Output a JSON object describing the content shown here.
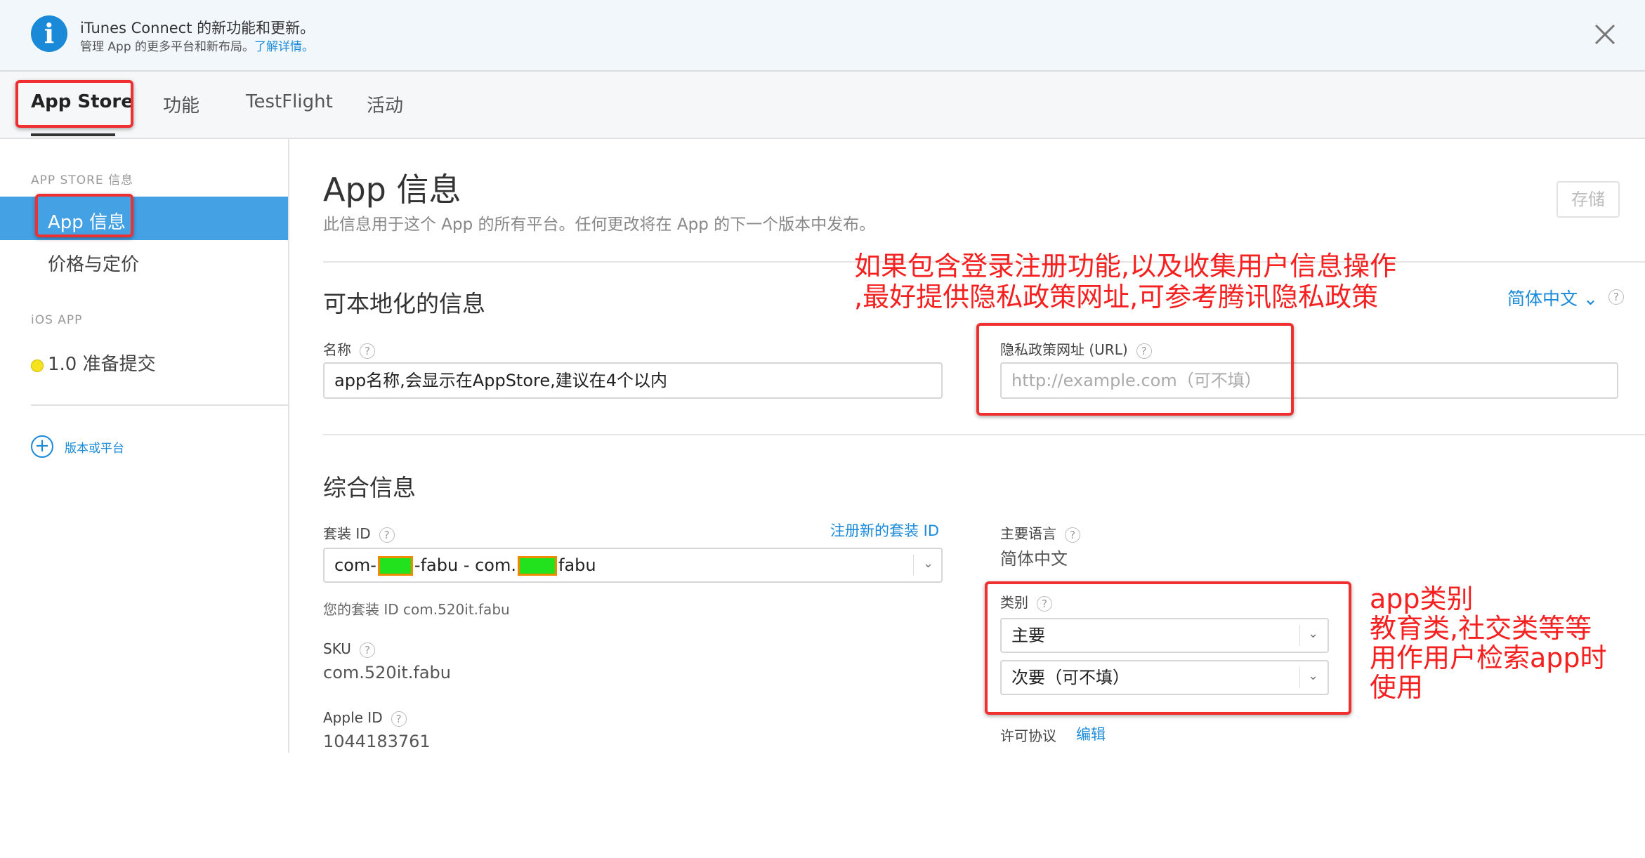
{
  "banner": {
    "title": "iTunes Connect 的新功能和更新。",
    "subtitle": "管理 App 的更多平台和新布局。",
    "link": "了解详情。"
  },
  "tabs": [
    "App Store",
    "功能",
    "TestFlight",
    "活动"
  ],
  "sidebar": {
    "section_info": "APP STORE 信息",
    "items": [
      "App 信息",
      "价格与定价"
    ],
    "section_ios": "iOS APP",
    "version": "1.0 准备提交",
    "add_link": "版本或平台"
  },
  "main": {
    "title": "App 信息",
    "description": "此信息用于这个 App 的所有平台。任何更改将在 App 的下一个版本中发布。",
    "save_label": "存储",
    "localizable": {
      "heading": "可本地化的信息",
      "language": "简体中文 ⌄",
      "name_label": "名称",
      "name_value": "app名称,会显示在AppStore,建议在4个以内",
      "privacy_label": "隐私政策网址 (URL)",
      "privacy_placeholder": "http://example.com（可不填）"
    },
    "general": {
      "heading": "综合信息",
      "bundle_label": "套装 ID",
      "register_bundle": "注册新的套装 ID",
      "bundle_value_a": "com-",
      "bundle_value_b": "-fabu - com.",
      "bundle_value_c": "fabu",
      "your_bundle_prefix": "您的套装 ID",
      "your_bundle_value": "com.520it.fabu",
      "sku_label": "SKU",
      "sku_value": "com.520it.fabu",
      "apple_id_label": "Apple ID",
      "apple_id_value": "1044183761",
      "primary_language_label": "主要语言",
      "primary_language_value": "简体中文",
      "category_label": "类别",
      "category_primary": "主要",
      "category_secondary": "次要（可不填）",
      "license_label": "许可协议",
      "license_edit": "编辑"
    }
  },
  "annotations": {
    "privacy_line1": "如果包含登录注册功能,以及收集用户信息操作",
    "privacy_line2": ",最好提供隐私政策网址,可参考腾讯隐私政策",
    "category_line1": "app类别",
    "category_line2": "教育类,社交类等等",
    "category_line3": "用作用户检索app时",
    "category_line4": "使用"
  },
  "colors": {
    "accent": "#1a8ad8",
    "sidebar_active": "#44a1e4",
    "annotation_red": "#f03030",
    "redacted_green": "#22e21d"
  }
}
